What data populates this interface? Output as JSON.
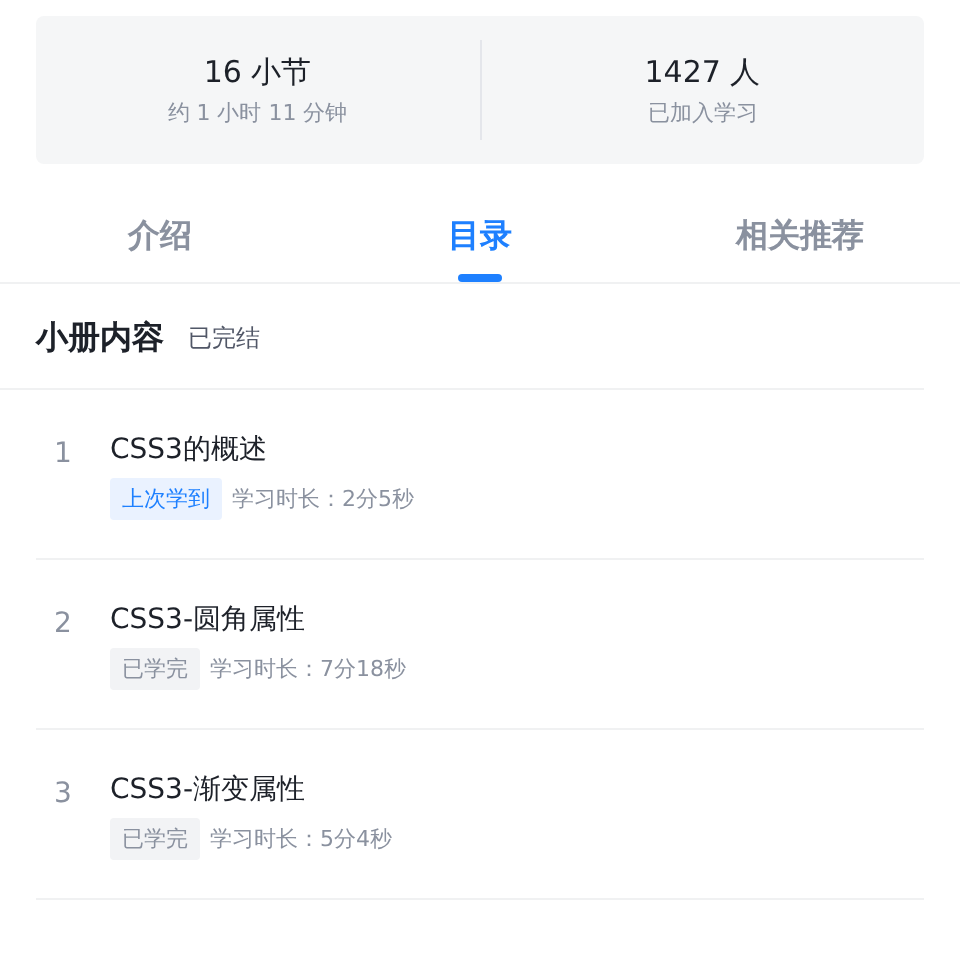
{
  "stats": [
    {
      "value": "16 小节",
      "caption": "约 1 小时 11 分钟"
    },
    {
      "value": "1427 人",
      "caption": "已加入学习"
    }
  ],
  "tabs": [
    {
      "label": "介绍",
      "selected": false
    },
    {
      "label": "目录",
      "selected": true
    },
    {
      "label": "相关推荐",
      "selected": false
    }
  ],
  "section": {
    "title": "小册内容",
    "status": "已完结"
  },
  "chapters": [
    {
      "number": "1",
      "title": "CSS3的概述",
      "tag": {
        "kind": "last",
        "label": "上次学到"
      },
      "duration": "学习时长：2分5秒"
    },
    {
      "number": "2",
      "title": "CSS3-圆角属性",
      "tag": {
        "kind": "done",
        "label": "已学完"
      },
      "duration": "学习时长：7分18秒"
    },
    {
      "number": "3",
      "title": "CSS3-渐变属性",
      "tag": {
        "kind": "done",
        "label": "已学完"
      },
      "duration": "学习时长：5分4秒"
    }
  ]
}
